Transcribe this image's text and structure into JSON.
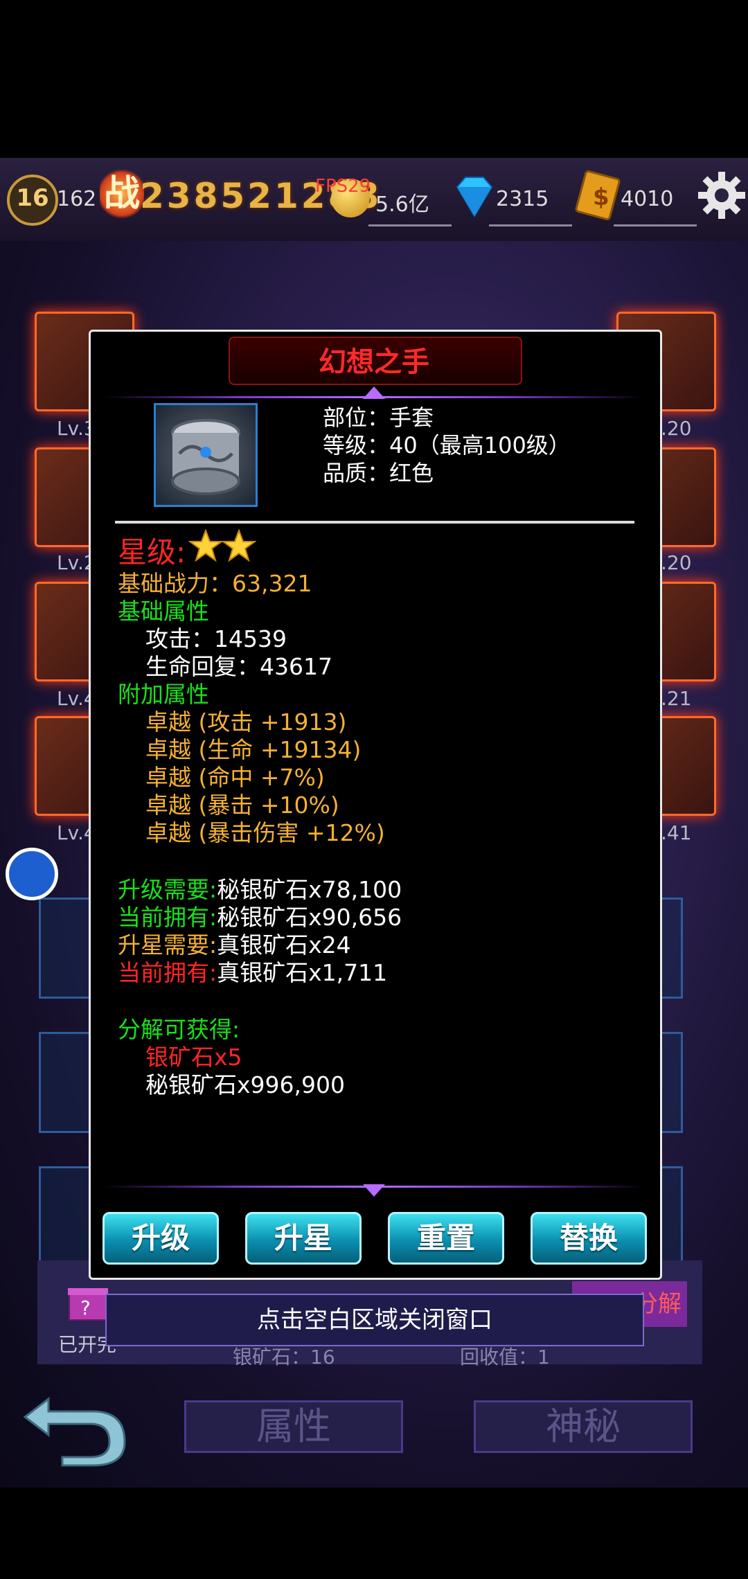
{
  "topbar": {
    "level": "16",
    "resource_count": "162",
    "power_icon_char": "战",
    "power": "238521288",
    "fps": "FPS29",
    "coins": "5.6亿",
    "gems": "2315",
    "cards": "4010"
  },
  "slots": {
    "left_labels": [
      "Lv.3",
      "Lv.2",
      "Lv.4",
      "Lv.4"
    ],
    "right_labels": [
      ".20",
      ".20",
      ".21",
      ".41"
    ]
  },
  "dialog": {
    "title": "幻想之手",
    "info": {
      "slot": "部位：手套",
      "level": "等级：40（最高100级）",
      "quality": "品质：红色"
    },
    "star_label": "星级:",
    "star_count": 2,
    "base_power": "基础战力：63,321",
    "base_attr_title": "基础属性",
    "base_attrs": [
      "攻击：14539",
      "生命回复：43617"
    ],
    "extra_attr_title": "附加属性",
    "extra_attrs": [
      "卓越 (攻击 +1913)",
      "卓越 (生命 +19134)",
      "卓越 (命中 +7%)",
      "卓越 (暴击 +10%)",
      "卓越 (暴击伤害 +12%)"
    ],
    "requirements": [
      {
        "label": "升级需要:",
        "value": "秘银矿石x78,100",
        "label_color": "#19e019"
      },
      {
        "label": "当前拥有:",
        "value": "秘银矿石x90,656",
        "label_color": "#19e019"
      },
      {
        "label": "升星需要:",
        "value": "真银矿石x24",
        "label_color": "#f4b133"
      },
      {
        "label": "当前拥有:",
        "value": "真银矿石x1,711",
        "label_color": "#ff2525"
      }
    ],
    "decompose_title": "分解可获得:",
    "decompose_items": [
      {
        "text": "银矿石x5",
        "color": "#ff2525"
      },
      {
        "text": "秘银矿石x996,900",
        "color": "#ffffff"
      }
    ],
    "buttons": {
      "upgrade": "升级",
      "star_up": "升星",
      "reset": "重置",
      "replace": "替换"
    }
  },
  "behind": {
    "opened_label": "已开完",
    "ore_label": "银矿石：16",
    "recycle_label": "回收值：1",
    "decompose_btn": "分解"
  },
  "close_tip": "点击空白区域关闭窗口",
  "bottom_tabs": {
    "attributes": "属性",
    "mystery": "神秘"
  }
}
